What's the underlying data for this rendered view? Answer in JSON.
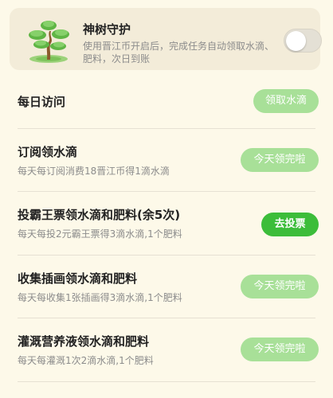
{
  "banner": {
    "title": "神树守护",
    "description": "使用晋江币开启后，完成任务自动领取水滴、肥料，次日到账",
    "toggle_on": false,
    "icon": "bonsai-tree-icon"
  },
  "tasks": [
    {
      "title": "每日访问",
      "description": "",
      "button": "领取水滴",
      "button_state": "light"
    },
    {
      "title": "订阅领水滴",
      "description": "每天每订阅消费18晋江币得1滴水滴",
      "button": "今天领完啦",
      "button_state": "light"
    },
    {
      "title": "投霸王票领水滴和肥料(余5次)",
      "description": "每天每投2元霸王票得3滴水滴,1个肥料",
      "button": "去投票",
      "button_state": "active"
    },
    {
      "title": "收集插画领水滴和肥料",
      "description": "每天每收集1张插画得3滴水滴,1个肥料",
      "button": "今天领完啦",
      "button_state": "light"
    },
    {
      "title": "灌溉营养液领水滴和肥料",
      "description": "每天每灌溉1次2滴水滴,1个肥料",
      "button": "今天领完啦",
      "button_state": "light"
    }
  ],
  "colors": {
    "background": "#fdf9e9",
    "banner_background": "#f3ecd9",
    "button_light": "#a8e098",
    "button_active": "#3cbd3a",
    "text_primary": "#222222",
    "text_secondary": "#8c8c8c"
  }
}
